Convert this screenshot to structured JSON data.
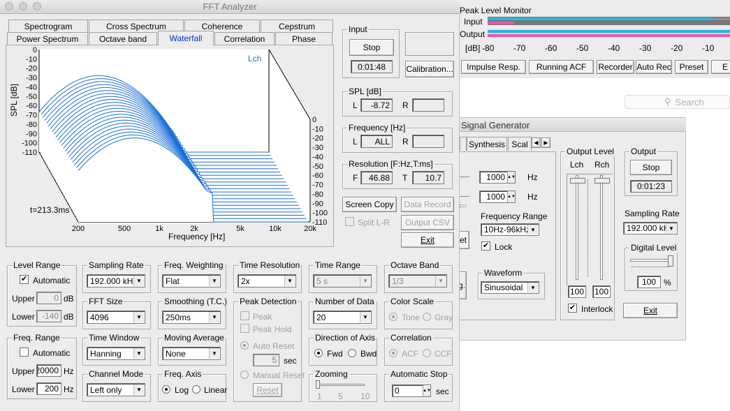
{
  "fft": {
    "title": "FFT Analyzer",
    "tabs_row1": [
      "Spectrogram",
      "Cross Spectrum",
      "Coherence",
      "Cepstrum"
    ],
    "tabs_row2": [
      "Power Spectrum",
      "Octave band",
      "Waterfall",
      "Correlation",
      "Phase"
    ],
    "active_tab": "Waterfall",
    "chart": {
      "channel": "Lch",
      "ylabel": "SPL [dB]",
      "xlabel": "Frequency [Hz]",
      "time_label": "t=213.3ms",
      "left_ticks": [
        "0",
        "-10",
        "-20",
        "-30",
        "-40",
        "-50",
        "-60",
        "-70",
        "-80",
        "-90",
        "-100",
        "-110"
      ],
      "right_ticks": [
        "0",
        "-10",
        "-20",
        "-30",
        "-40",
        "-50",
        "-60",
        "-70",
        "-80",
        "-90",
        "-100",
        "-110"
      ],
      "x_ticks": [
        "200",
        "500",
        "1k",
        "2k",
        "5k",
        "10k",
        "20k"
      ]
    },
    "input": {
      "label": "Input",
      "stop": "Stop",
      "time": "0:01:48",
      "calibration": "Calibration..."
    },
    "spl": {
      "label": "SPL [dB]",
      "l": "L",
      "l_val": "-8.72",
      "r": "R",
      "r_val": ""
    },
    "freq": {
      "label": "Frequency [Hz]",
      "l": "L",
      "l_val": "ALL",
      "r": "R",
      "r_val": ""
    },
    "res": {
      "label": "Resolution [F:Hz,T:ms]",
      "f": "F",
      "f_val": "46.88",
      "t": "T",
      "t_val": "10.7"
    },
    "buttons": {
      "screen_copy": "Screen Copy",
      "data_record": "Data Record",
      "split": "Split L-R",
      "output_csv": "Output CSV",
      "exit": "Exit"
    },
    "level_range": {
      "label": "Level Range",
      "auto": "Automatic",
      "upper": "Upper",
      "upper_val": "0",
      "lower": "Lower",
      "lower_val": "-140",
      "unit": "dB"
    },
    "freq_range": {
      "label": "Freq. Range",
      "auto": "Automatic",
      "upper": "Upper",
      "upper_val": "20000",
      "lower": "Lower",
      "lower_val": "200",
      "unit": "Hz"
    },
    "sampling_rate": {
      "label": "Sampling Rate",
      "value": "192.000 kHz"
    },
    "fft_size": {
      "label": "FFT Size",
      "value": "4096"
    },
    "time_window": {
      "label": "Time Window",
      "value": "Hanning"
    },
    "channel_mode": {
      "label": "Channel Mode",
      "value": "Left only"
    },
    "freq_weighting": {
      "label": "Freq. Weighting",
      "value": "Flat"
    },
    "smoothing": {
      "label": "Smoothing (T.C.)",
      "value": "250ms"
    },
    "moving_average": {
      "label": "Moving Average",
      "value": "None"
    },
    "freq_axis": {
      "label": "Freq. Axis",
      "log": "Log",
      "linear": "Linear"
    },
    "time_resolution": {
      "label": "Time Resolution",
      "value": "2x"
    },
    "peak_detection": {
      "label": "Peak Detection",
      "peak": "Peak",
      "peak_hold": "Peak Hold",
      "auto_reset": "Auto Reset",
      "sec_val": "5",
      "sec": "sec",
      "manual_reset": "Manual Reset",
      "reset": "Reset"
    },
    "time_range": {
      "label": "Time Range",
      "value": "5 s"
    },
    "number_of_data": {
      "label": "Number of Data",
      "value": "20"
    },
    "direction": {
      "label": "Direction of Axis",
      "fwd": "Fwd",
      "bwd": "Bwd"
    },
    "zooming": {
      "label": "Zooming",
      "ticks": [
        "1",
        "5",
        "10"
      ]
    },
    "octave_band": {
      "label": "Octave Band",
      "value": "1/3"
    },
    "color_scale": {
      "label": "Color Scale",
      "tone": "Tone",
      "gray": "Gray"
    },
    "correlation": {
      "label": "Correlation",
      "acf": "ACF",
      "ccf": "CCF"
    },
    "auto_stop": {
      "label": "Automatic Stop",
      "value": "0",
      "unit": "sec"
    }
  },
  "plm": {
    "title": "Peak Level Monitor",
    "input": "Input",
    "output": "Output",
    "db": "[dB]",
    "ticks": [
      "-80",
      "-70",
      "-60",
      "-50",
      "-40",
      "-30",
      "-20",
      "-10"
    ],
    "buttons": [
      "Impulse Resp.",
      "Running ACF",
      "Recorder",
      "Auto Rec",
      "Preset"
    ],
    "search": "Search"
  },
  "sg": {
    "title": "Signal Generator",
    "tabs": [
      "Synthesis",
      "Scal"
    ],
    "freq1": "1000",
    "freq2": "1000",
    "hz": "Hz",
    "freq_range_label": "Frequency Range",
    "freq_range": "10Hz-96kHz",
    "lock": "Lock",
    "waveform_label": "Waveform",
    "waveform": "Sinusoidal",
    "output_level": "Output Level",
    "lch": "Lch",
    "rch": "Rch",
    "lch_val": "100",
    "rch_val": "100",
    "interlock": "Interlock",
    "output_label": "Output",
    "stop": "Stop",
    "time": "0:01:23",
    "sampling_rate_label": "Sampling Rate",
    "sampling_rate": "192.000 kH:",
    "digital_level_label": "Digital Level",
    "digital_level": "100",
    "pct": "%",
    "exit": "Exit",
    "et": "et",
    "g": "g."
  },
  "colors": {
    "accent": "#3b78e0",
    "meter_cyan": "#27b5e6",
    "meter_pink": "#e85aa8",
    "curve": "#1a6fd6"
  }
}
